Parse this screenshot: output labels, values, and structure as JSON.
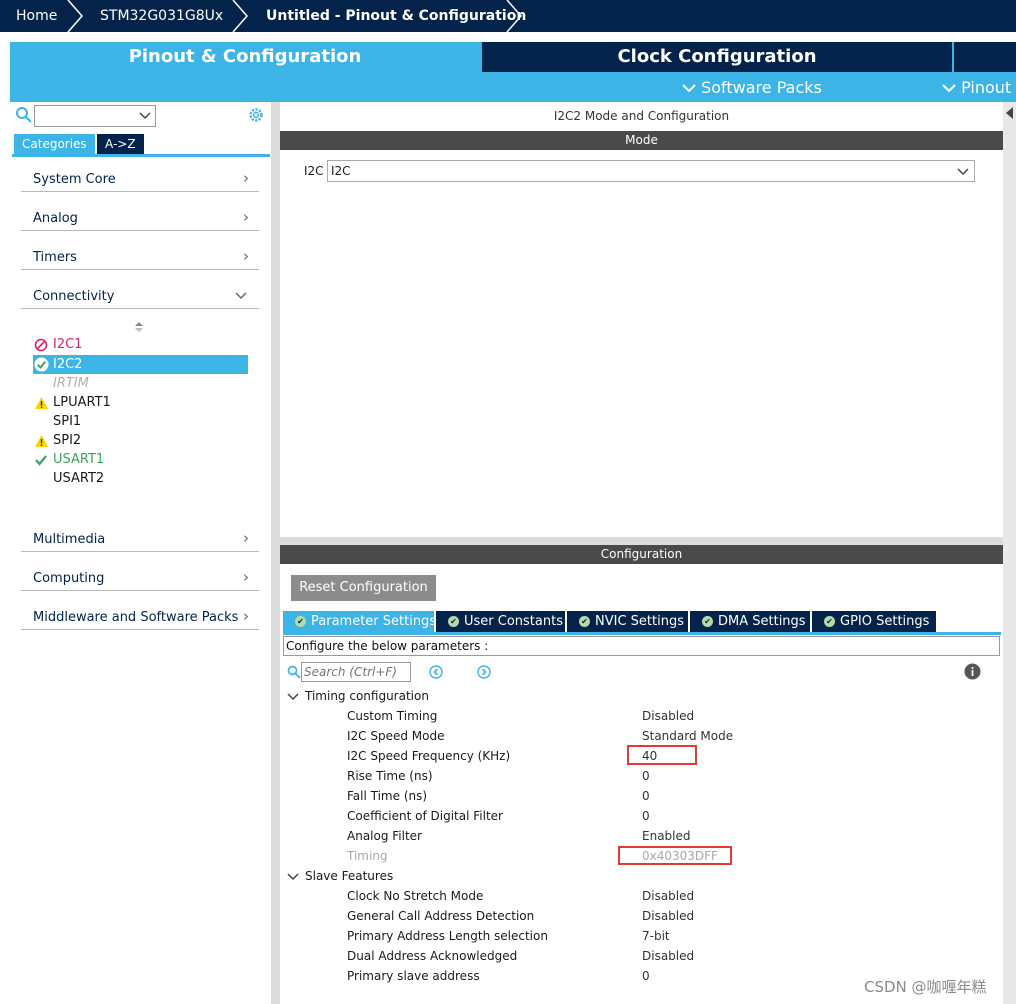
{
  "breadcrumb": {
    "home": "Home",
    "device": "STM32G031G8Ux",
    "project": "Untitled - Pinout & Configuration"
  },
  "main_tabs": {
    "pinout_config": "Pinout & Configuration",
    "clock_config": "Clock Configuration",
    "software_packs": "Software Packs",
    "pinout": "Pinout"
  },
  "left": {
    "search_value": "",
    "tab_categories": "Categories",
    "tab_az": "A->Z",
    "categories_top": [
      {
        "label": "System Core"
      },
      {
        "label": "Analog"
      },
      {
        "label": "Timers"
      },
      {
        "label": "Connectivity"
      }
    ],
    "peripherals": [
      {
        "label": "I2C1",
        "status": "disabled"
      },
      {
        "label": "I2C2",
        "status": "ok-selected"
      },
      {
        "label": "IRTIM",
        "status": "unavailable"
      },
      {
        "label": "LPUART1",
        "status": "warning"
      },
      {
        "label": "SPI1",
        "status": "none"
      },
      {
        "label": "SPI2",
        "status": "warning"
      },
      {
        "label": "USART1",
        "status": "ok"
      },
      {
        "label": "USART2",
        "status": "none"
      }
    ],
    "categories_bottom": [
      {
        "label": "Multimedia"
      },
      {
        "label": "Computing"
      },
      {
        "label": "Middleware and Software Packs"
      }
    ]
  },
  "right": {
    "title": "I2C2 Mode and Configuration",
    "mode_header": "Mode",
    "mode_field_label": "I2C",
    "mode_field_value": "I2C",
    "config_header": "Configuration",
    "reset_button": "Reset Configuration",
    "param_tabs": [
      {
        "label": "Parameter Settings"
      },
      {
        "label": "User Constants"
      },
      {
        "label": "NVIC Settings"
      },
      {
        "label": "DMA Settings"
      },
      {
        "label": "GPIO Settings"
      }
    ],
    "configure_text": "Configure the below parameters :",
    "search_placeholder": "Search (Ctrl+F)",
    "sections": [
      {
        "title": "Timing configuration",
        "params": [
          {
            "name": "Custom Timing",
            "value": "Disabled"
          },
          {
            "name": "I2C Speed Mode",
            "value": "Standard Mode"
          },
          {
            "name": "I2C Speed Frequency (KHz)",
            "value": "40"
          },
          {
            "name": "Rise Time (ns)",
            "value": "0"
          },
          {
            "name": "Fall Time (ns)",
            "value": "0"
          },
          {
            "name": "Coefficient of Digital Filter",
            "value": "0"
          },
          {
            "name": "Analog Filter",
            "value": "Enabled"
          },
          {
            "name": "Timing",
            "value": "0x40303DFF"
          }
        ]
      },
      {
        "title": "Slave Features",
        "params": [
          {
            "name": "Clock No Stretch Mode",
            "value": "Disabled"
          },
          {
            "name": "General Call Address Detection",
            "value": "Disabled"
          },
          {
            "name": "Primary Address Length selection",
            "value": "7-bit"
          },
          {
            "name": "Dual Address Acknowledged",
            "value": "Disabled"
          },
          {
            "name": "Primary slave address",
            "value": "0"
          }
        ]
      }
    ]
  },
  "watermark": "CSDN @咖喱年糕",
  "colors": {
    "navy": "#03234b",
    "accent_blue": "#3cb4e6",
    "highlight_red": "#e53935",
    "ok_green": "#3ca55c",
    "warn_yellow": "#ffd200",
    "disabled_pink": "#d6246e"
  }
}
